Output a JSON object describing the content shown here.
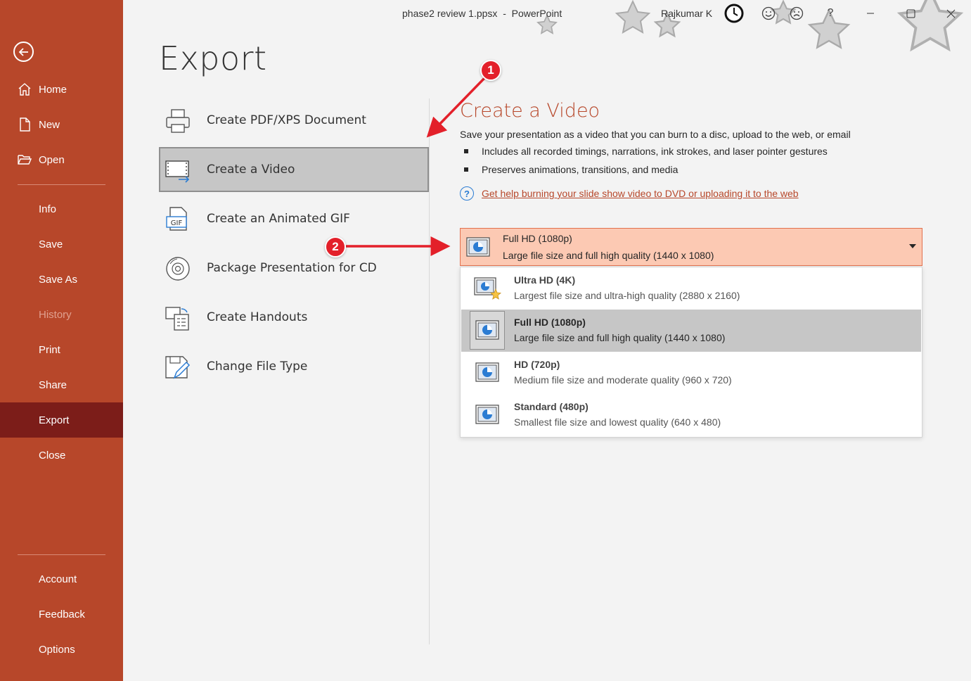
{
  "titlebar": {
    "title": "phase2 review 1.ppsx  -  PowerPoint",
    "user": "Rajkumar K",
    "help_label": "?"
  },
  "sidebar": {
    "top_items": [
      {
        "label": "Home",
        "icon": "home-icon"
      },
      {
        "label": "New",
        "icon": "new-document-icon"
      },
      {
        "label": "Open",
        "icon": "folder-open-icon"
      }
    ],
    "items": [
      {
        "label": "Info"
      },
      {
        "label": "Save"
      },
      {
        "label": "Save As"
      },
      {
        "label": "History",
        "disabled": true
      },
      {
        "label": "Print"
      },
      {
        "label": "Share"
      },
      {
        "label": "Export",
        "active": true
      },
      {
        "label": "Close"
      }
    ],
    "bottom_items": [
      {
        "label": "Account"
      },
      {
        "label": "Feedback"
      },
      {
        "label": "Options"
      }
    ]
  },
  "page": {
    "heading": "Export"
  },
  "export_options": [
    {
      "label": "Create PDF/XPS Document",
      "icon": "printer-pdf-icon"
    },
    {
      "label": "Create a Video",
      "icon": "video-export-icon",
      "selected": true
    },
    {
      "label": "Create an Animated GIF",
      "icon": "gif-icon",
      "icon_text": "GIF"
    },
    {
      "label": "Package Presentation for CD",
      "icon": "cd-icon"
    },
    {
      "label": "Create Handouts",
      "icon": "handouts-icon"
    },
    {
      "label": "Change File Type",
      "icon": "change-file-type-icon"
    }
  ],
  "pane": {
    "title": "Create a Video",
    "description": "Save your presentation as a video that you can burn to a disc, upload to the web, or email",
    "bullets": [
      "Includes all recorded timings, narrations, ink strokes, and laser pointer gestures",
      "Preserves animations, transitions, and media"
    ],
    "help_link": "Get help burning your slide show video to DVD or uploading it to the web"
  },
  "quality_dropdown": {
    "selected_title": "Full HD (1080p)",
    "selected_sub": "Large file size and full high quality (1440 x 1080)",
    "options": [
      {
        "title": "Ultra HD (4K)",
        "sub": "Largest file size and ultra-high quality (2880 x 2160)"
      },
      {
        "title": "Full HD (1080p)",
        "sub": "Large file size and full high quality (1440 x 1080)",
        "selected": true
      },
      {
        "title": "HD (720p)",
        "sub": "Medium file size and moderate quality (960 x 720)"
      },
      {
        "title": "Standard (480p)",
        "sub": "Smallest file size and lowest quality (640 x 480)"
      }
    ]
  },
  "annotations": {
    "badge1": "1",
    "badge2": "2"
  },
  "colors": {
    "accent": "#b7472a",
    "sidebar_active": "#7c1d19",
    "dropdown_bg": "#fcc9b3",
    "annotation_red": "#e3202a"
  }
}
